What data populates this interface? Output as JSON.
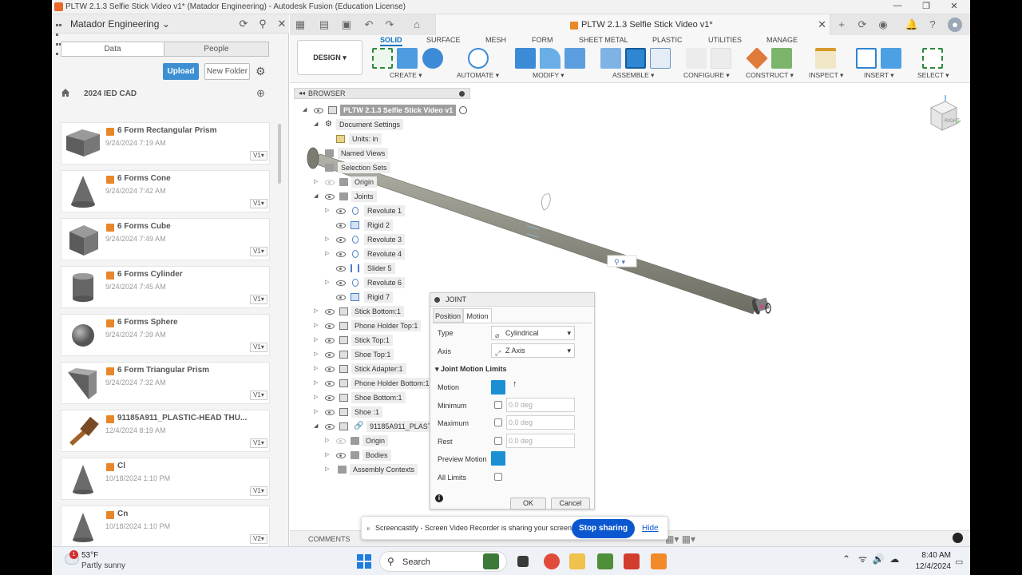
{
  "window": {
    "title": "PLTW 2.1.3 Selfie Stick Video v1* (Matador Engineering) - Autodesk Fusion (Education License)",
    "minimize": "—",
    "maximize": "❐",
    "close": "✕"
  },
  "data_panel": {
    "hub": "Matador Engineering",
    "tabs": [
      "Data",
      "People"
    ],
    "upload": "Upload",
    "new_folder": "New Folder",
    "breadcrumb": "2024 IED CAD",
    "files": [
      {
        "name": "6 Form Rectangular Prism",
        "date": "9/24/2024 7:19 AM",
        "version": "V1▾"
      },
      {
        "name": "6 Forms Cone",
        "date": "9/24/2024 7:42 AM",
        "version": "V1▾"
      },
      {
        "name": "6 Forms Cube",
        "date": "9/24/2024 7:49 AM",
        "version": "V1▾"
      },
      {
        "name": "6 Forms Cylinder",
        "date": "9/24/2024 7:45 AM",
        "version": "V1▾"
      },
      {
        "name": "6 Forms Sphere",
        "date": "9/24/2024 7:39 AM",
        "version": "V1▾"
      },
      {
        "name": "6 Form Triangular Prism",
        "date": "9/24/2024 7:32 AM",
        "version": "V1▾"
      },
      {
        "name": "91185A911_PLASTIC-HEAD THU...",
        "date": "12/4/2024 8:19 AM",
        "version": "V1▾"
      },
      {
        "name": "Cl",
        "date": "10/18/2024 1:10 PM",
        "version": "V1▾"
      },
      {
        "name": "Cn",
        "date": "10/18/2024 1:10 PM",
        "version": "V2▾"
      }
    ]
  },
  "document": {
    "tab_title": "PLTW 2.1.3 Selfie Stick Video v1*"
  },
  "toolbar": {
    "workspace": "DESIGN ▾",
    "tabs": [
      "SOLID",
      "SURFACE",
      "MESH",
      "FORM",
      "SHEET METAL",
      "PLASTIC",
      "UTILITIES",
      "MANAGE"
    ],
    "groups": [
      "CREATE ▾",
      "AUTOMATE ▾",
      "MODIFY ▾",
      "ASSEMBLE ▾",
      "CONFIGURE ▾",
      "CONSTRUCT ▾",
      "INSPECT ▾",
      "INSERT ▾",
      "SELECT ▾"
    ]
  },
  "browser": {
    "title": "BROWSER",
    "root": "PLTW 2.1.3 Selfie Stick Video v1",
    "document_settings": "Document Settings",
    "units": "Units: in",
    "named_views": "Named Views",
    "selection_sets": "Selection Sets",
    "origin": "Origin",
    "joints": "Joints",
    "joint_items": [
      "Revolute 1",
      "Rigid 2",
      "Revolute 3",
      "Revolute 4",
      "Slider 5",
      "Revolute 6",
      "Rigid 7"
    ],
    "components": [
      "Stick Bottom:1",
      "Phone Holder Top:1",
      "Stick Top:1",
      "Shoe Top:1",
      "Stick Adapter:1",
      "Phone Holder Bottom:1",
      "Shoe Bottom:1",
      "Shoe :1",
      "91185A911_PLAST"
    ],
    "sub_origin": "Origin",
    "bodies": "Bodies",
    "assembly_contexts": "Assembly Contexts"
  },
  "joint_dialog": {
    "title": "JOINT",
    "tabs": [
      "Position",
      "Motion"
    ],
    "type_label": "Type",
    "type_value": "Cylindrical",
    "axis_label": "Axis",
    "axis_value": "Z Axis",
    "section": "Joint Motion Limits",
    "motion_label": "Motion",
    "minimum_label": "Minimum",
    "minimum_value": "0.0 deg",
    "maximum_label": "Maximum",
    "maximum_value": "0.0 deg",
    "rest_label": "Rest",
    "rest_value": "0.0 deg",
    "preview_label": "Preview Motion",
    "all_limits_label": "All Limits",
    "ok": "OK",
    "cancel": "Cancel"
  },
  "viewcube": {
    "face": "RIGHT"
  },
  "share_banner": {
    "text": "Screencastify - Screen Video Recorder is sharing your screen.",
    "stop": "Stop sharing",
    "hide": "Hide"
  },
  "comments": "COMMENTS",
  "taskbar": {
    "weather_badge": "1",
    "temperature": "53°F",
    "condition": "Partly sunny",
    "search": "Search",
    "time": "8:40 AM",
    "date": "12/4/2024"
  },
  "colors": {
    "accent": "#0a73c4",
    "upload": "#3d8fd1",
    "stop_sharing": "#0b57d0",
    "joint_blue": "#1b8fd4",
    "fusion_orange": "#e8872a",
    "stick": "#8e8d82"
  }
}
